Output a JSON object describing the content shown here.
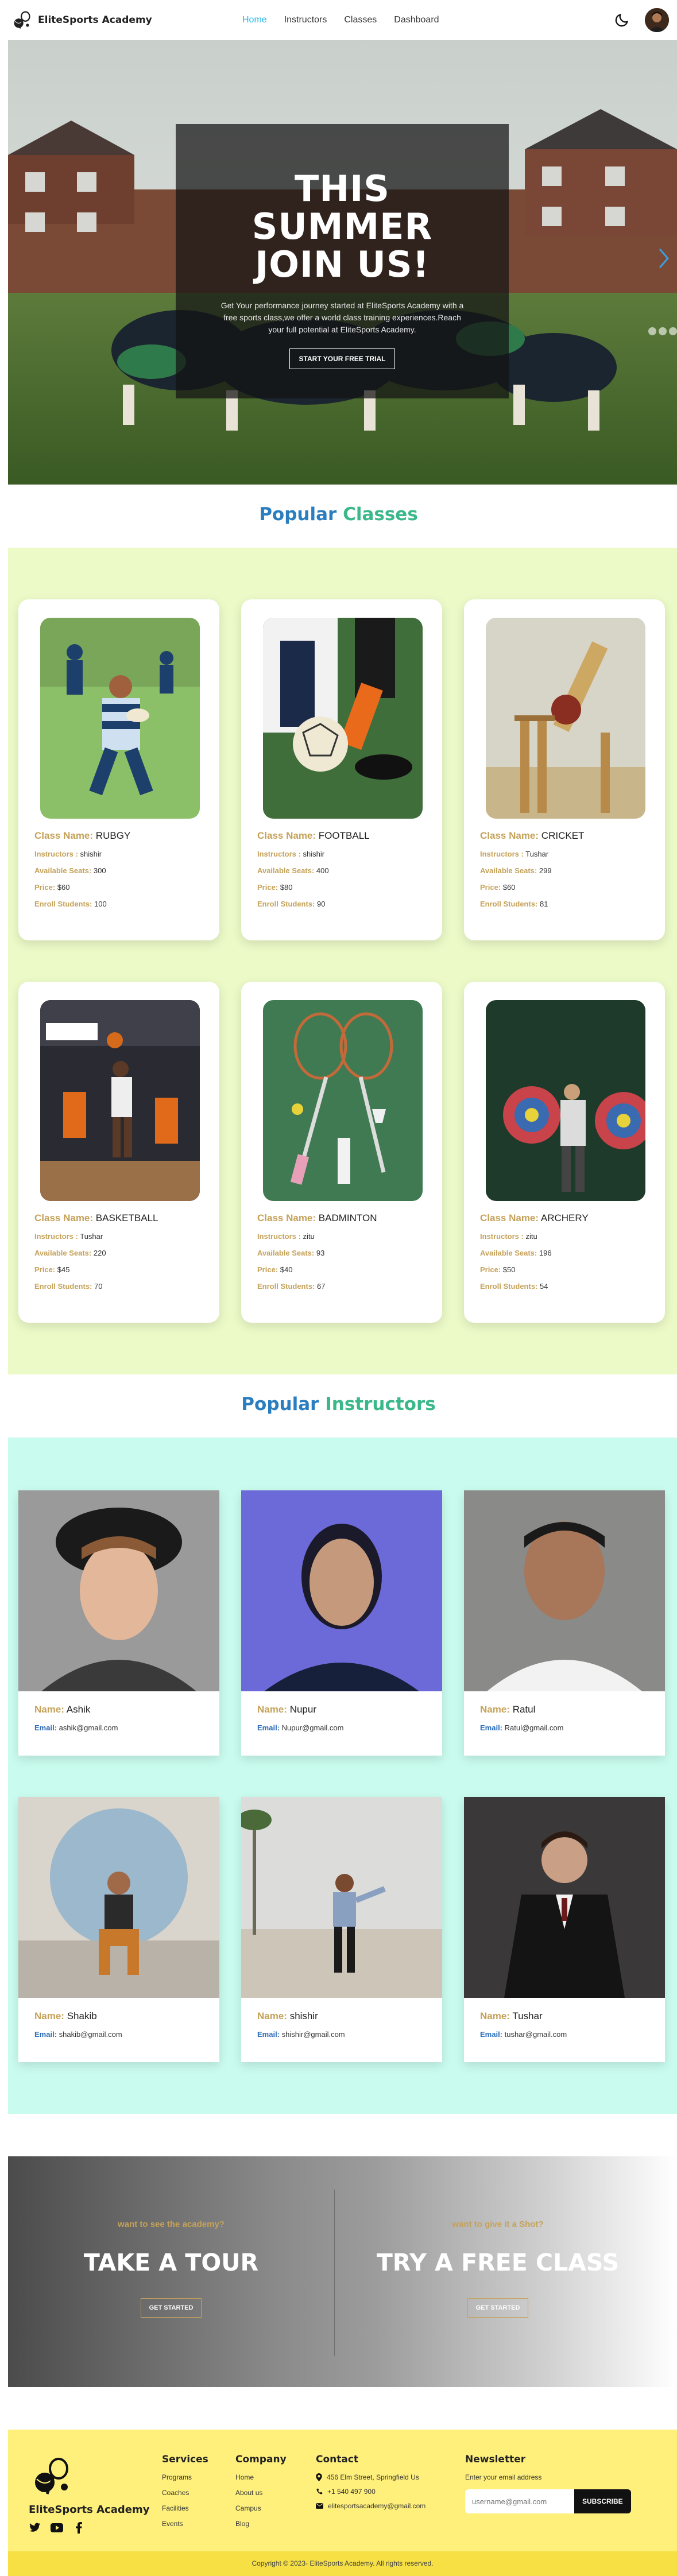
{
  "nav": {
    "brand": "EliteSports Academy",
    "links": [
      "Home",
      "Instructors",
      "Classes",
      "Dashboard"
    ]
  },
  "hero": {
    "title_lines": [
      "THIS",
      "SUMMER",
      "JOIN US!"
    ],
    "description": "Get Your performance journey started at EliteSports Academy with a free sports class,we offer a world class training experiences.Reach your full potential at EliteSports Academy.",
    "button": "START YOUR FREE TRIAL"
  },
  "classes_section": {
    "title_a": "Popular",
    "title_b": "Classes",
    "labels": {
      "class_name": "Class Name:",
      "instructors": "Instructors :",
      "seats": "Available Seats:",
      "price": "Price:",
      "enrolled": "Enroll Students:"
    },
    "items": [
      {
        "name": "RUBGY",
        "instructor": "shishir",
        "seats": "300",
        "price": "$60",
        "enrolled": "100"
      },
      {
        "name": "FOOTBALL",
        "instructor": "shishir",
        "seats": "400",
        "price": "$80",
        "enrolled": "90"
      },
      {
        "name": "CRICKET",
        "instructor": "Tushar",
        "seats": "299",
        "price": "$60",
        "enrolled": "81"
      },
      {
        "name": "BASKETBALL",
        "instructor": "Tushar",
        "seats": "220",
        "price": "$45",
        "enrolled": "70"
      },
      {
        "name": "BADMINTON",
        "instructor": "zitu",
        "seats": "93",
        "price": "$40",
        "enrolled": "67"
      },
      {
        "name": "ARCHERY",
        "instructor": "zitu",
        "seats": "196",
        "price": "$50",
        "enrolled": "54"
      }
    ]
  },
  "instructors_section": {
    "title_a": "Popular",
    "title_b": "Instructors",
    "labels": {
      "name": "Name:",
      "email": "Email:"
    },
    "items": [
      {
        "name": "Ashik",
        "email": "ashik@gmail.com"
      },
      {
        "name": "Nupur",
        "email": "Nupur@gmail.com"
      },
      {
        "name": "Ratul",
        "email": "Ratul@gmail.com"
      },
      {
        "name": "Shakib",
        "email": "shakib@gmail.com"
      },
      {
        "name": "shishir",
        "email": "shishir@gmail.com"
      },
      {
        "name": "Tushar",
        "email": "tushar@gmail.com"
      }
    ]
  },
  "cta": {
    "left": {
      "kicker": "want to see the academy?",
      "title": "TAKE A TOUR",
      "button": "GET STARTED"
    },
    "right": {
      "kicker": "want to give it a Shot?",
      "title": "TRY A FREE CLASS",
      "button": "GET STARTED"
    }
  },
  "footer": {
    "brand": "EliteSports Academy",
    "services": {
      "title": "Services",
      "links": [
        "Programs",
        "Coaches",
        "Facilities",
        "Events"
      ]
    },
    "company": {
      "title": "Company",
      "links": [
        "Home",
        "About us",
        "Campus",
        "Blog"
      ]
    },
    "contact": {
      "title": "Contact",
      "address": "456 Elm Street, Springfield Us",
      "phone": "+1 540 497 900",
      "email": "elitesportsacademy@gmail.com"
    },
    "newsletter": {
      "title": "Newsletter",
      "label": "Enter your email address",
      "placeholder": "username@gmail.com",
      "button": "SUBSCRIBE"
    },
    "copyright": "Copyright © 2023- EliteSports Academy. All rights reserved."
  },
  "colors": {
    "nav_active": "#22b8e8",
    "label_gold": "#c5a25a",
    "classes_bg": "#ecfac8",
    "instructors_bg": "#c9fbee",
    "footer_bg": "#fff07c",
    "footer_bottom": "#f7e043",
    "email_label": "#2a6bb8"
  },
  "icons": [
    "sports-logo-icon",
    "moon-icon",
    "chevron-right-icon",
    "twitter-icon",
    "youtube-icon",
    "facebook-icon",
    "location-icon",
    "phone-icon",
    "mail-icon"
  ]
}
